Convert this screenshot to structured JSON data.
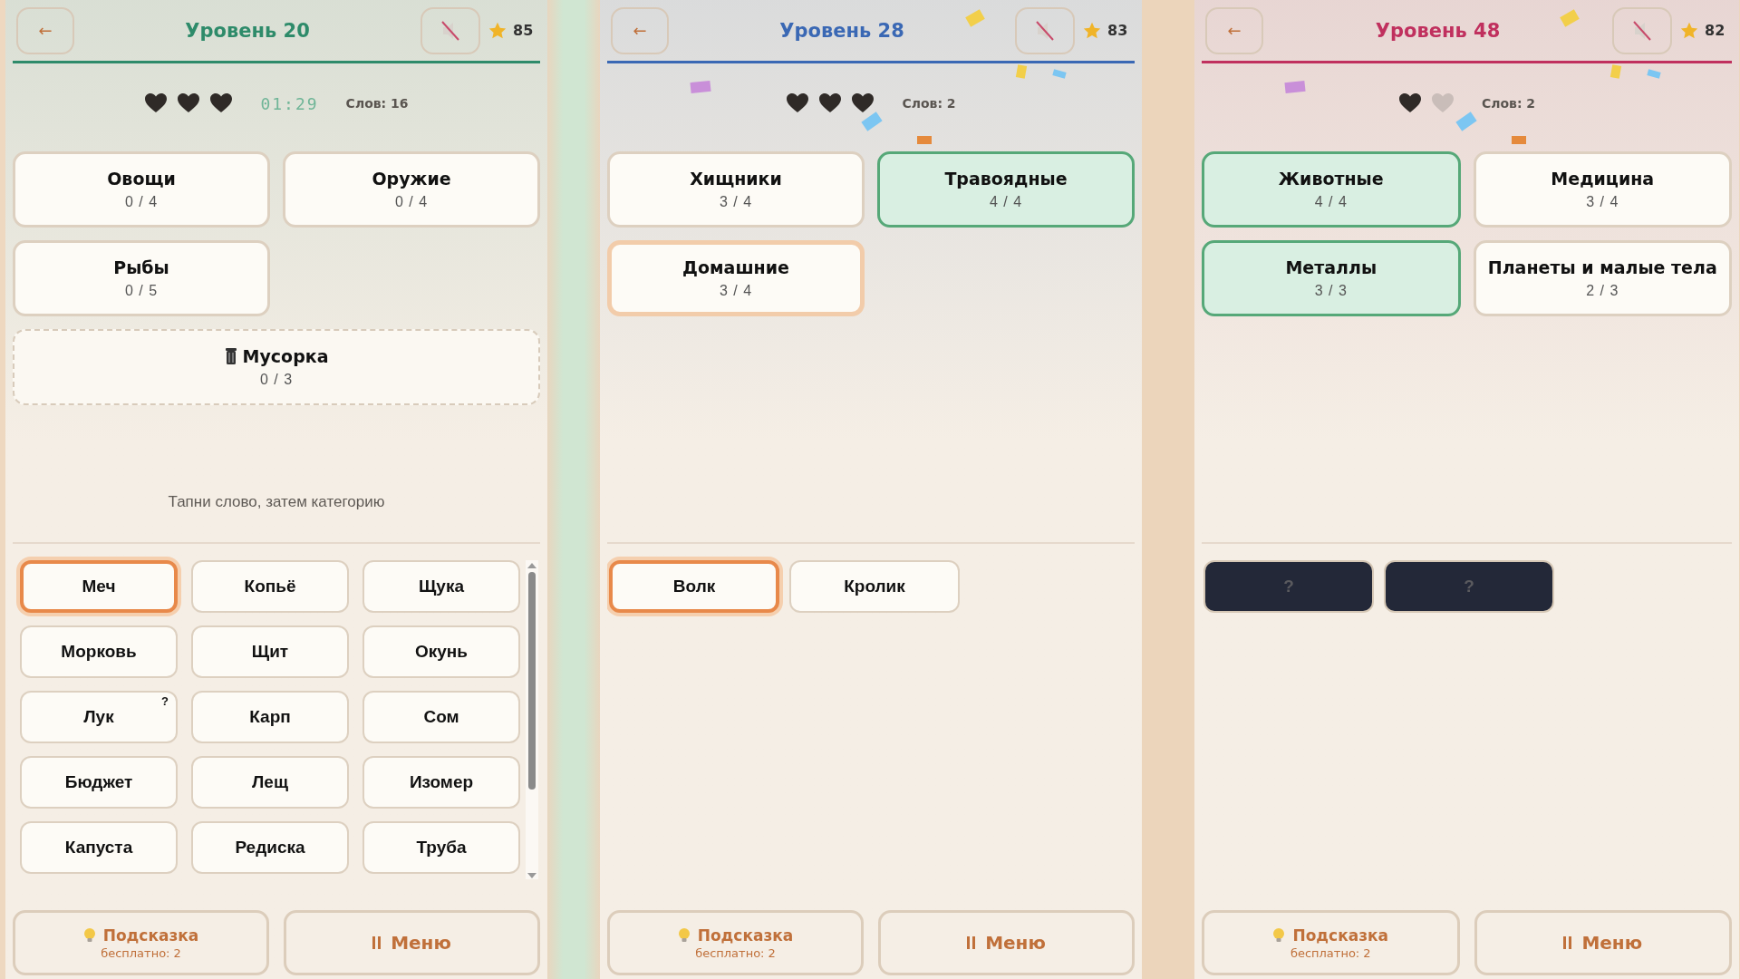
{
  "panels": [
    {
      "color": "#2e8b6a",
      "back": "←",
      "title": "Уровень 20",
      "stars_count": "85",
      "hearts": [
        {
          "filled": true
        },
        {
          "filled": true
        },
        {
          "filled": true
        }
      ],
      "timer": "01:29",
      "words_count": "Слов: 16",
      "confetti": false,
      "categories": [
        {
          "kind": "normal",
          "name": "Овощи",
          "progress": "0 / 4",
          "completed": false,
          "selected": false
        },
        {
          "kind": "normal",
          "name": "Оружие",
          "progress": "0 / 4",
          "completed": false,
          "selected": false
        },
        {
          "kind": "normal",
          "name": "Рыбы",
          "progress": "0 / 5",
          "completed": false,
          "selected": false
        },
        {
          "kind": "trash",
          "name": "Мусорка",
          "progress": "0 / 3",
          "completed": false,
          "selected": false
        }
      ],
      "hint_text": "Тапни слово, затем категорию",
      "scrollbar": true,
      "words": [
        {
          "kind": "word",
          "text": "Меч",
          "selected": true
        },
        {
          "kind": "word",
          "text": "Копьё",
          "selected": false
        },
        {
          "kind": "word",
          "text": "Щука",
          "selected": false
        },
        {
          "kind": "word",
          "text": "Морковь",
          "selected": false
        },
        {
          "kind": "word",
          "text": "Щит",
          "selected": false
        },
        {
          "kind": "word",
          "text": "Окунь",
          "selected": false
        },
        {
          "kind": "word",
          "text": "Лук",
          "selected": false,
          "hint_mark": "?"
        },
        {
          "kind": "word",
          "text": "Карп",
          "selected": false
        },
        {
          "kind": "word",
          "text": "Сом",
          "selected": false
        },
        {
          "kind": "word",
          "text": "Бюджет",
          "selected": false
        },
        {
          "kind": "word",
          "text": "Лещ",
          "selected": false
        },
        {
          "kind": "word",
          "text": "Изомер",
          "selected": false
        },
        {
          "kind": "word",
          "text": "Капуста",
          "selected": false
        },
        {
          "kind": "word",
          "text": "Редиска",
          "selected": false
        },
        {
          "kind": "word",
          "text": "Труба",
          "selected": false
        }
      ],
      "hint_button": {
        "label": "Подсказка",
        "sub": "бесплатно: 2"
      },
      "menu_button": {
        "label": "Меню"
      }
    },
    {
      "color": "#3a68b4",
      "back": "←",
      "title": "Уровень 28",
      "stars_count": "83",
      "hearts": [
        {
          "filled": true
        },
        {
          "filled": true
        },
        {
          "filled": true
        }
      ],
      "words_count": "Слов: 2",
      "confetti": true,
      "categories": [
        {
          "kind": "normal",
          "name": "Хищники",
          "progress": "3 / 4",
          "completed": false,
          "selected": false
        },
        {
          "kind": "normal",
          "name": "Травоядные",
          "progress": "4 / 4",
          "completed": true,
          "selected": false
        },
        {
          "kind": "normal",
          "name": "Домашние",
          "progress": "3 / 4",
          "completed": false,
          "selected": true
        }
      ],
      "scrollbar": false,
      "words": [
        {
          "kind": "word",
          "text": "Волк",
          "selected": true
        },
        {
          "kind": "word",
          "text": "Кролик",
          "selected": false
        }
      ],
      "hint_button": {
        "label": "Подсказка",
        "sub": "бесплатно: 2"
      },
      "menu_button": {
        "label": "Меню"
      }
    },
    {
      "color": "#c0305e",
      "back": "←",
      "title": "Уровень 48",
      "stars_count": "82",
      "hearts": [
        {
          "filled": true
        },
        {
          "filled": false
        }
      ],
      "words_count": "Слов: 2",
      "confetti": true,
      "categories": [
        {
          "kind": "normal",
          "name": "Животные",
          "progress": "4 / 4",
          "completed": true,
          "selected": false
        },
        {
          "kind": "normal",
          "name": "Медицина",
          "progress": "3 / 4",
          "completed": false,
          "selected": false
        },
        {
          "kind": "normal",
          "name": "Металлы",
          "progress": "3 / 3",
          "completed": true,
          "selected": false
        },
        {
          "kind": "normal",
          "name": "Планеты и малые тела",
          "progress": "2 / 3",
          "completed": false,
          "selected": false
        }
      ],
      "scrollbar": false,
      "words": [
        {
          "kind": "hidden",
          "text": "?",
          "selected": false
        },
        {
          "kind": "hidden",
          "text": "?",
          "selected": false
        }
      ],
      "hint_button": {
        "label": "Подсказка",
        "sub": "бесплатно: 2"
      },
      "menu_button": {
        "label": "Меню"
      }
    }
  ]
}
